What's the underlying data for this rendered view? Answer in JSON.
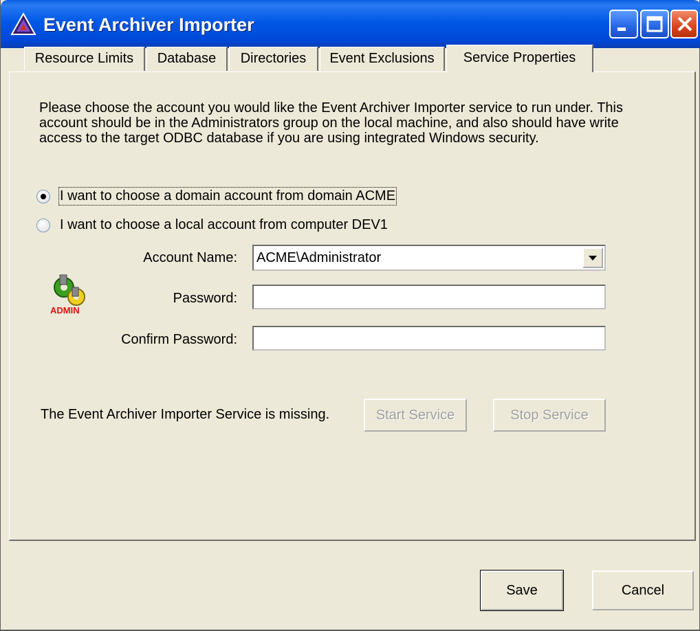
{
  "window": {
    "title": "Event Archiver Importer",
    "titlebar_color": "#0054e3",
    "controls": [
      "minimize-icon",
      "maximize-icon",
      "close-icon"
    ]
  },
  "tabs": [
    {
      "label": "Resource Limits",
      "active": false
    },
    {
      "label": "Database",
      "active": false
    },
    {
      "label": "Directories",
      "active": false
    },
    {
      "label": "Event Exclusions",
      "active": false
    },
    {
      "label": "Service Properties",
      "active": true
    }
  ],
  "service_properties": {
    "description": "Please choose the account you would like the Event Archiver Importer service to run under.  This account should be in the Administrators group on the local machine, and also should have write access to the target ODBC database if you are using integrated Windows security.",
    "account_type": {
      "options": [
        {
          "label": "I want to choose a domain account from domain ACME",
          "selected": true
        },
        {
          "label": "I want to choose a local account from computer DEV1",
          "selected": false
        }
      ]
    },
    "account_name": {
      "label": "Account Name:",
      "value": "ACME\\Administrator"
    },
    "password": {
      "label": "Password:",
      "value": ""
    },
    "confirm_password": {
      "label": "Confirm Password:",
      "value": ""
    },
    "admin_icon_caption": "ADMIN",
    "service_status": "The Event Archiver Importer Service is missing.",
    "start_service_label": "Start Service",
    "stop_service_label": "Stop Service"
  },
  "footer": {
    "save_label": "Save",
    "cancel_label": "Cancel"
  }
}
